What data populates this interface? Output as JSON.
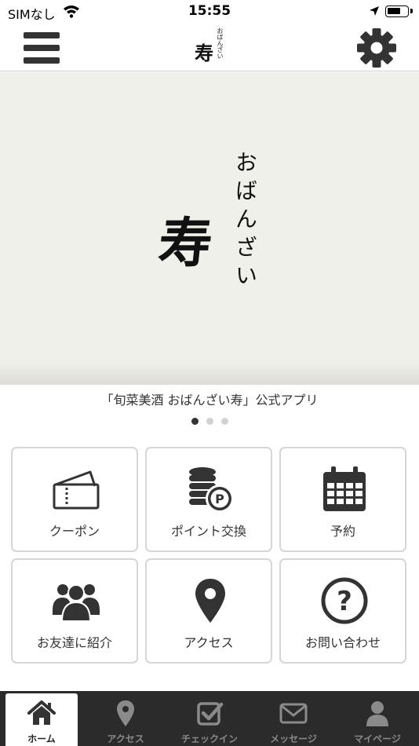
{
  "status_bar": {
    "carrier": "SIMなし",
    "time": "15:55",
    "battery_level": 0.7
  },
  "header": {
    "menu_icon": "hamburger-menu-icon",
    "logo_main": "寿",
    "logo_sub": "おばんざい",
    "settings_icon": "gear-icon"
  },
  "hero": {
    "logo_main": "寿",
    "logo_sub": "おばんざい",
    "background": "#f0f0ea"
  },
  "caption": "「旬菜美酒 おばんざい寿」公式アプリ",
  "carousel": {
    "page_count": 3,
    "active_index": 0
  },
  "grid": [
    {
      "label": "クーポン",
      "icon": "ticket-icon"
    },
    {
      "label": "ポイント交換",
      "icon": "coins-point-icon"
    },
    {
      "label": "予約",
      "icon": "calendar-icon"
    },
    {
      "label": "お友達に紹介",
      "icon": "people-group-icon"
    },
    {
      "label": "アクセス",
      "icon": "map-pin-icon"
    },
    {
      "label": "お問い合わせ",
      "icon": "question-circle-icon"
    }
  ],
  "tabs": [
    {
      "label": "ホーム",
      "icon": "home-icon",
      "active": true
    },
    {
      "label": "アクセス",
      "icon": "map-pin-icon",
      "active": false
    },
    {
      "label": "チェックイン",
      "icon": "checkbox-icon",
      "active": false
    },
    {
      "label": "メッセージ",
      "icon": "envelope-icon",
      "active": false
    },
    {
      "label": "マイページ",
      "icon": "user-icon",
      "active": false
    }
  ],
  "colors": {
    "icon_dark": "#333333",
    "tab_bar_bg": "#2b2b2b",
    "tab_inactive": "#8a8a8a",
    "tile_border": "#d6d6d6"
  }
}
